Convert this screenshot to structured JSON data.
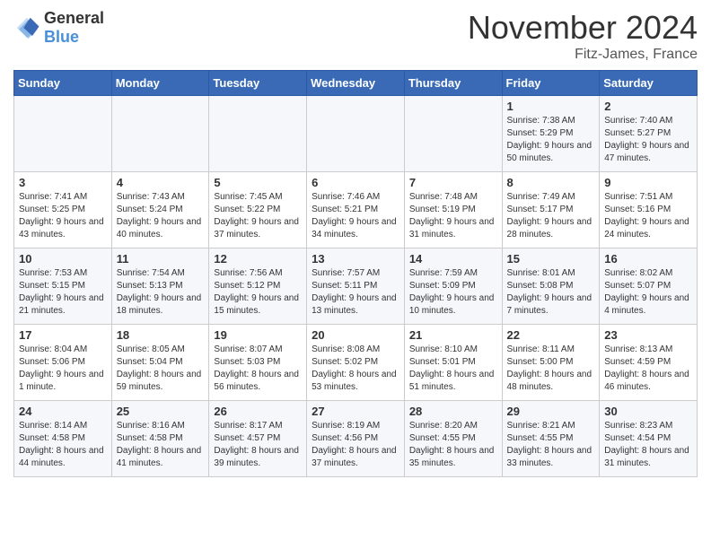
{
  "header": {
    "logo_general": "General",
    "logo_blue": "Blue",
    "month_title": "November 2024",
    "location": "Fitz-James, France"
  },
  "days_of_week": [
    "Sunday",
    "Monday",
    "Tuesday",
    "Wednesday",
    "Thursday",
    "Friday",
    "Saturday"
  ],
  "weeks": [
    [
      {
        "day": "",
        "info": ""
      },
      {
        "day": "",
        "info": ""
      },
      {
        "day": "",
        "info": ""
      },
      {
        "day": "",
        "info": ""
      },
      {
        "day": "",
        "info": ""
      },
      {
        "day": "1",
        "info": "Sunrise: 7:38 AM\nSunset: 5:29 PM\nDaylight: 9 hours and 50 minutes."
      },
      {
        "day": "2",
        "info": "Sunrise: 7:40 AM\nSunset: 5:27 PM\nDaylight: 9 hours and 47 minutes."
      }
    ],
    [
      {
        "day": "3",
        "info": "Sunrise: 7:41 AM\nSunset: 5:25 PM\nDaylight: 9 hours and 43 minutes."
      },
      {
        "day": "4",
        "info": "Sunrise: 7:43 AM\nSunset: 5:24 PM\nDaylight: 9 hours and 40 minutes."
      },
      {
        "day": "5",
        "info": "Sunrise: 7:45 AM\nSunset: 5:22 PM\nDaylight: 9 hours and 37 minutes."
      },
      {
        "day": "6",
        "info": "Sunrise: 7:46 AM\nSunset: 5:21 PM\nDaylight: 9 hours and 34 minutes."
      },
      {
        "day": "7",
        "info": "Sunrise: 7:48 AM\nSunset: 5:19 PM\nDaylight: 9 hours and 31 minutes."
      },
      {
        "day": "8",
        "info": "Sunrise: 7:49 AM\nSunset: 5:17 PM\nDaylight: 9 hours and 28 minutes."
      },
      {
        "day": "9",
        "info": "Sunrise: 7:51 AM\nSunset: 5:16 PM\nDaylight: 9 hours and 24 minutes."
      }
    ],
    [
      {
        "day": "10",
        "info": "Sunrise: 7:53 AM\nSunset: 5:15 PM\nDaylight: 9 hours and 21 minutes."
      },
      {
        "day": "11",
        "info": "Sunrise: 7:54 AM\nSunset: 5:13 PM\nDaylight: 9 hours and 18 minutes."
      },
      {
        "day": "12",
        "info": "Sunrise: 7:56 AM\nSunset: 5:12 PM\nDaylight: 9 hours and 15 minutes."
      },
      {
        "day": "13",
        "info": "Sunrise: 7:57 AM\nSunset: 5:11 PM\nDaylight: 9 hours and 13 minutes."
      },
      {
        "day": "14",
        "info": "Sunrise: 7:59 AM\nSunset: 5:09 PM\nDaylight: 9 hours and 10 minutes."
      },
      {
        "day": "15",
        "info": "Sunrise: 8:01 AM\nSunset: 5:08 PM\nDaylight: 9 hours and 7 minutes."
      },
      {
        "day": "16",
        "info": "Sunrise: 8:02 AM\nSunset: 5:07 PM\nDaylight: 9 hours and 4 minutes."
      }
    ],
    [
      {
        "day": "17",
        "info": "Sunrise: 8:04 AM\nSunset: 5:06 PM\nDaylight: 9 hours and 1 minute."
      },
      {
        "day": "18",
        "info": "Sunrise: 8:05 AM\nSunset: 5:04 PM\nDaylight: 8 hours and 59 minutes."
      },
      {
        "day": "19",
        "info": "Sunrise: 8:07 AM\nSunset: 5:03 PM\nDaylight: 8 hours and 56 minutes."
      },
      {
        "day": "20",
        "info": "Sunrise: 8:08 AM\nSunset: 5:02 PM\nDaylight: 8 hours and 53 minutes."
      },
      {
        "day": "21",
        "info": "Sunrise: 8:10 AM\nSunset: 5:01 PM\nDaylight: 8 hours and 51 minutes."
      },
      {
        "day": "22",
        "info": "Sunrise: 8:11 AM\nSunset: 5:00 PM\nDaylight: 8 hours and 48 minutes."
      },
      {
        "day": "23",
        "info": "Sunrise: 8:13 AM\nSunset: 4:59 PM\nDaylight: 8 hours and 46 minutes."
      }
    ],
    [
      {
        "day": "24",
        "info": "Sunrise: 8:14 AM\nSunset: 4:58 PM\nDaylight: 8 hours and 44 minutes."
      },
      {
        "day": "25",
        "info": "Sunrise: 8:16 AM\nSunset: 4:58 PM\nDaylight: 8 hours and 41 minutes."
      },
      {
        "day": "26",
        "info": "Sunrise: 8:17 AM\nSunset: 4:57 PM\nDaylight: 8 hours and 39 minutes."
      },
      {
        "day": "27",
        "info": "Sunrise: 8:19 AM\nSunset: 4:56 PM\nDaylight: 8 hours and 37 minutes."
      },
      {
        "day": "28",
        "info": "Sunrise: 8:20 AM\nSunset: 4:55 PM\nDaylight: 8 hours and 35 minutes."
      },
      {
        "day": "29",
        "info": "Sunrise: 8:21 AM\nSunset: 4:55 PM\nDaylight: 8 hours and 33 minutes."
      },
      {
        "day": "30",
        "info": "Sunrise: 8:23 AM\nSunset: 4:54 PM\nDaylight: 8 hours and 31 minutes."
      }
    ]
  ]
}
